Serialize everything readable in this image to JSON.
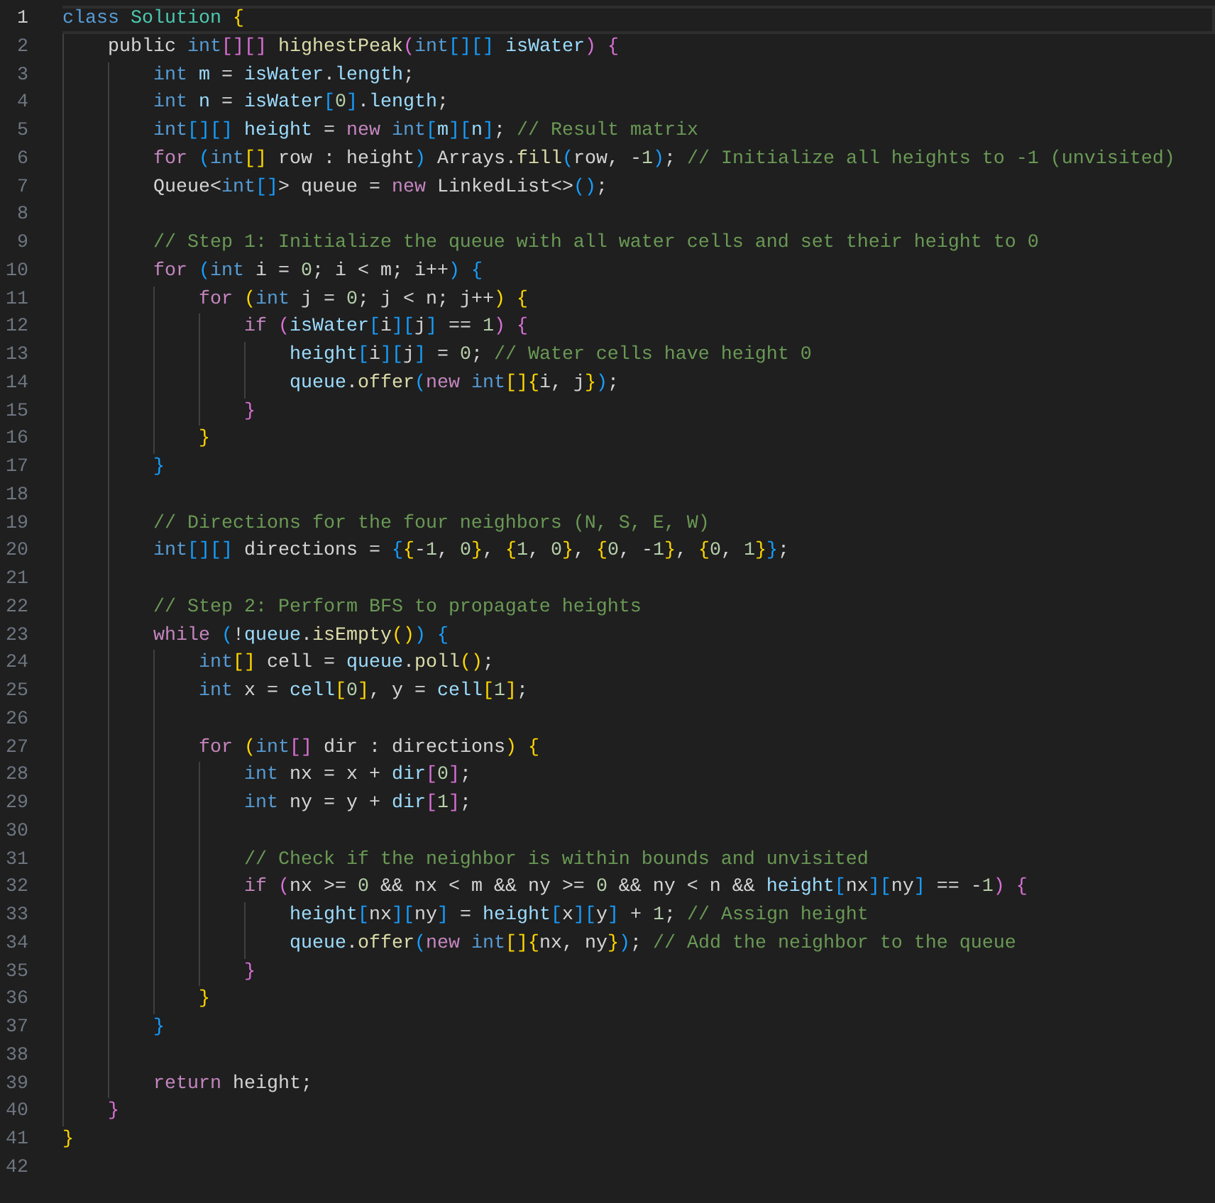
{
  "editor": {
    "lines": [
      {
        "number": "1",
        "selected": true,
        "tokens": [
          {
            "kind": "type",
            "text": "class"
          },
          {
            "kind": "class",
            "text": " Solution"
          },
          {
            "kind": "gold",
            "text": " {"
          }
        ]
      },
      {
        "number": "2",
        "selected": false,
        "tokens": [
          {
            "kind": "plain",
            "text": "    public "
          },
          {
            "kind": "type",
            "text": "int"
          },
          {
            "kind": "pink",
            "text": "[][]"
          },
          {
            "kind": "func",
            "text": " highestPeak"
          },
          {
            "kind": "pink",
            "text": "("
          },
          {
            "kind": "type",
            "text": "int"
          },
          {
            "kind": "blue",
            "text": "[][]"
          },
          {
            "kind": "var",
            "text": " isWater"
          },
          {
            "kind": "pink",
            "text": ")"
          },
          {
            "kind": "pink",
            "text": " {"
          }
        ]
      },
      {
        "number": "3",
        "selected": false,
        "tokens": [
          {
            "kind": "type",
            "text": "        int"
          },
          {
            "kind": "var",
            "text": " m"
          },
          {
            "kind": "plain",
            "text": " = "
          },
          {
            "kind": "var",
            "text": "isWater"
          },
          {
            "kind": "plain",
            "text": "."
          },
          {
            "kind": "var",
            "text": "length"
          },
          {
            "kind": "plain",
            "text": ";"
          }
        ]
      },
      {
        "number": "4",
        "selected": false,
        "tokens": [
          {
            "kind": "type",
            "text": "        int"
          },
          {
            "kind": "var",
            "text": " n"
          },
          {
            "kind": "plain",
            "text": " = "
          },
          {
            "kind": "var",
            "text": "isWater"
          },
          {
            "kind": "blue",
            "text": "["
          },
          {
            "kind": "num",
            "text": "0"
          },
          {
            "kind": "blue",
            "text": "]"
          },
          {
            "kind": "plain",
            "text": "."
          },
          {
            "kind": "var",
            "text": "length"
          },
          {
            "kind": "plain",
            "text": ";"
          }
        ]
      },
      {
        "number": "5",
        "selected": false,
        "tokens": [
          {
            "kind": "type",
            "text": "        int"
          },
          {
            "kind": "blue",
            "text": "[][]"
          },
          {
            "kind": "var",
            "text": " height"
          },
          {
            "kind": "plain",
            "text": " = "
          },
          {
            "kind": "control",
            "text": "new"
          },
          {
            "kind": "type",
            "text": " int"
          },
          {
            "kind": "blue",
            "text": "["
          },
          {
            "kind": "var",
            "text": "m"
          },
          {
            "kind": "blue",
            "text": "]["
          },
          {
            "kind": "var",
            "text": "n"
          },
          {
            "kind": "blue",
            "text": "]"
          },
          {
            "kind": "plain",
            "text": "; "
          },
          {
            "kind": "comment",
            "text": "// Result matrix"
          }
        ]
      },
      {
        "number": "6",
        "selected": false,
        "tokens": [
          {
            "kind": "control",
            "text": "        for"
          },
          {
            "kind": "blue",
            "text": " ("
          },
          {
            "kind": "type",
            "text": "int"
          },
          {
            "kind": "gold",
            "text": "[]"
          },
          {
            "kind": "plain",
            "text": " row : height"
          },
          {
            "kind": "blue",
            "text": ")"
          },
          {
            "kind": "plain",
            "text": " Arrays."
          },
          {
            "kind": "func",
            "text": "fill"
          },
          {
            "kind": "blue",
            "text": "("
          },
          {
            "kind": "plain",
            "text": "row, -"
          },
          {
            "kind": "num",
            "text": "1"
          },
          {
            "kind": "blue",
            "text": ")"
          },
          {
            "kind": "plain",
            "text": "; "
          },
          {
            "kind": "comment",
            "text": "// Initialize all heights to -1 (unvisited)"
          }
        ]
      },
      {
        "number": "7",
        "selected": false,
        "tokens": [
          {
            "kind": "plain",
            "text": "        Queue<"
          },
          {
            "kind": "type",
            "text": "int"
          },
          {
            "kind": "blue",
            "text": "[]"
          },
          {
            "kind": "plain",
            "text": "> queue = "
          },
          {
            "kind": "control",
            "text": "new"
          },
          {
            "kind": "plain",
            "text": " LinkedList<>"
          },
          {
            "kind": "blue",
            "text": "()"
          },
          {
            "kind": "plain",
            "text": ";"
          }
        ]
      },
      {
        "number": "8",
        "selected": false
      },
      {
        "number": "9",
        "selected": false,
        "tokens": [
          {
            "kind": "comment",
            "text": "        // Step 1: Initialize the queue with all water cells and set their height to 0"
          }
        ]
      },
      {
        "number": "10",
        "selected": false,
        "tokens": [
          {
            "kind": "control",
            "text": "        for"
          },
          {
            "kind": "blue",
            "text": " ("
          },
          {
            "kind": "type",
            "text": "int"
          },
          {
            "kind": "plain",
            "text": " i = "
          },
          {
            "kind": "num",
            "text": "0"
          },
          {
            "kind": "plain",
            "text": "; i < m; i++"
          },
          {
            "kind": "blue",
            "text": ")"
          },
          {
            "kind": "blue",
            "text": " {"
          }
        ]
      },
      {
        "number": "11",
        "selected": false,
        "tokens": [
          {
            "kind": "control",
            "text": "            for"
          },
          {
            "kind": "gold",
            "text": " ("
          },
          {
            "kind": "type",
            "text": "int"
          },
          {
            "kind": "plain",
            "text": " j = "
          },
          {
            "kind": "num",
            "text": "0"
          },
          {
            "kind": "plain",
            "text": "; j < n; j++"
          },
          {
            "kind": "gold",
            "text": ")"
          },
          {
            "kind": "gold",
            "text": " {"
          }
        ]
      },
      {
        "number": "12",
        "selected": false,
        "tokens": [
          {
            "kind": "control",
            "text": "                if"
          },
          {
            "kind": "pink",
            "text": " ("
          },
          {
            "kind": "var",
            "text": "isWater"
          },
          {
            "kind": "blue",
            "text": "["
          },
          {
            "kind": "plain",
            "text": "i"
          },
          {
            "kind": "blue",
            "text": "]["
          },
          {
            "kind": "plain",
            "text": "j"
          },
          {
            "kind": "blue",
            "text": "]"
          },
          {
            "kind": "plain",
            "text": " == "
          },
          {
            "kind": "num",
            "text": "1"
          },
          {
            "kind": "pink",
            "text": ")"
          },
          {
            "kind": "pink",
            "text": " {"
          }
        ]
      },
      {
        "number": "13",
        "selected": false,
        "tokens": [
          {
            "kind": "var",
            "text": "                    height"
          },
          {
            "kind": "blue",
            "text": "["
          },
          {
            "kind": "plain",
            "text": "i"
          },
          {
            "kind": "blue",
            "text": "]["
          },
          {
            "kind": "plain",
            "text": "j"
          },
          {
            "kind": "blue",
            "text": "]"
          },
          {
            "kind": "plain",
            "text": " = "
          },
          {
            "kind": "num",
            "text": "0"
          },
          {
            "kind": "plain",
            "text": "; "
          },
          {
            "kind": "comment",
            "text": "// Water cells have height 0"
          }
        ]
      },
      {
        "number": "14",
        "selected": false,
        "tokens": [
          {
            "kind": "var",
            "text": "                    queue"
          },
          {
            "kind": "plain",
            "text": "."
          },
          {
            "kind": "func",
            "text": "offer"
          },
          {
            "kind": "blue",
            "text": "("
          },
          {
            "kind": "control",
            "text": "new"
          },
          {
            "kind": "type",
            "text": " int"
          },
          {
            "kind": "gold",
            "text": "[]{"
          },
          {
            "kind": "plain",
            "text": "i, j"
          },
          {
            "kind": "gold",
            "text": "}"
          },
          {
            "kind": "blue",
            "text": ")"
          },
          {
            "kind": "plain",
            "text": ";"
          }
        ]
      },
      {
        "number": "15",
        "selected": false,
        "tokens": [
          {
            "kind": "pink",
            "text": "                }"
          }
        ]
      },
      {
        "number": "16",
        "selected": false,
        "tokens": [
          {
            "kind": "gold",
            "text": "            }"
          }
        ]
      },
      {
        "number": "17",
        "selected": false,
        "tokens": [
          {
            "kind": "blue",
            "text": "        }"
          }
        ]
      },
      {
        "number": "18",
        "selected": false
      },
      {
        "number": "19",
        "selected": false,
        "tokens": [
          {
            "kind": "comment",
            "text": "        // Directions for the four neighbors (N, S, E, W)"
          }
        ]
      },
      {
        "number": "20",
        "selected": false,
        "tokens": [
          {
            "kind": "type",
            "text": "        int"
          },
          {
            "kind": "blue",
            "text": "[][]"
          },
          {
            "kind": "plain",
            "text": " directions = "
          },
          {
            "kind": "blue",
            "text": "{"
          },
          {
            "kind": "gold",
            "text": "{"
          },
          {
            "kind": "plain",
            "text": "-"
          },
          {
            "kind": "num",
            "text": "1"
          },
          {
            "kind": "plain",
            "text": ", "
          },
          {
            "kind": "num",
            "text": "0"
          },
          {
            "kind": "gold",
            "text": "}"
          },
          {
            "kind": "plain",
            "text": ", "
          },
          {
            "kind": "gold",
            "text": "{"
          },
          {
            "kind": "num",
            "text": "1"
          },
          {
            "kind": "plain",
            "text": ", "
          },
          {
            "kind": "num",
            "text": "0"
          },
          {
            "kind": "gold",
            "text": "}"
          },
          {
            "kind": "plain",
            "text": ", "
          },
          {
            "kind": "gold",
            "text": "{"
          },
          {
            "kind": "num",
            "text": "0"
          },
          {
            "kind": "plain",
            "text": ", -"
          },
          {
            "kind": "num",
            "text": "1"
          },
          {
            "kind": "gold",
            "text": "}"
          },
          {
            "kind": "plain",
            "text": ", "
          },
          {
            "kind": "gold",
            "text": "{"
          },
          {
            "kind": "num",
            "text": "0"
          },
          {
            "kind": "plain",
            "text": ", "
          },
          {
            "kind": "num",
            "text": "1"
          },
          {
            "kind": "gold",
            "text": "}"
          },
          {
            "kind": "blue",
            "text": "}"
          },
          {
            "kind": "plain",
            "text": ";"
          }
        ]
      },
      {
        "number": "21",
        "selected": false
      },
      {
        "number": "22",
        "selected": false,
        "tokens": [
          {
            "kind": "comment",
            "text": "        // Step 2: Perform BFS to propagate heights"
          }
        ]
      },
      {
        "number": "23",
        "selected": false,
        "tokens": [
          {
            "kind": "control",
            "text": "        while"
          },
          {
            "kind": "blue",
            "text": " ("
          },
          {
            "kind": "plain",
            "text": "!"
          },
          {
            "kind": "var",
            "text": "queue"
          },
          {
            "kind": "plain",
            "text": "."
          },
          {
            "kind": "func",
            "text": "isEmpty"
          },
          {
            "kind": "gold",
            "text": "()"
          },
          {
            "kind": "blue",
            "text": ")"
          },
          {
            "kind": "blue",
            "text": " {"
          }
        ]
      },
      {
        "number": "24",
        "selected": false,
        "tokens": [
          {
            "kind": "type",
            "text": "            int"
          },
          {
            "kind": "gold",
            "text": "[]"
          },
          {
            "kind": "plain",
            "text": " cell = "
          },
          {
            "kind": "var",
            "text": "queue"
          },
          {
            "kind": "plain",
            "text": "."
          },
          {
            "kind": "func",
            "text": "poll"
          },
          {
            "kind": "gold",
            "text": "()"
          },
          {
            "kind": "plain",
            "text": ";"
          }
        ]
      },
      {
        "number": "25",
        "selected": false,
        "tokens": [
          {
            "kind": "type",
            "text": "            int"
          },
          {
            "kind": "plain",
            "text": " x = "
          },
          {
            "kind": "var",
            "text": "cell"
          },
          {
            "kind": "gold",
            "text": "["
          },
          {
            "kind": "num",
            "text": "0"
          },
          {
            "kind": "gold",
            "text": "]"
          },
          {
            "kind": "plain",
            "text": ", y = "
          },
          {
            "kind": "var",
            "text": "cell"
          },
          {
            "kind": "gold",
            "text": "["
          },
          {
            "kind": "num",
            "text": "1"
          },
          {
            "kind": "gold",
            "text": "]"
          },
          {
            "kind": "plain",
            "text": ";"
          }
        ]
      },
      {
        "number": "26",
        "selected": false
      },
      {
        "number": "27",
        "selected": false,
        "tokens": [
          {
            "kind": "control",
            "text": "            for"
          },
          {
            "kind": "gold",
            "text": " ("
          },
          {
            "kind": "type",
            "text": "int"
          },
          {
            "kind": "pink",
            "text": "[]"
          },
          {
            "kind": "plain",
            "text": " dir : directions"
          },
          {
            "kind": "gold",
            "text": ")"
          },
          {
            "kind": "gold",
            "text": " {"
          }
        ]
      },
      {
        "number": "28",
        "selected": false,
        "tokens": [
          {
            "kind": "type",
            "text": "                int"
          },
          {
            "kind": "plain",
            "text": " nx = x + "
          },
          {
            "kind": "var",
            "text": "dir"
          },
          {
            "kind": "pink",
            "text": "["
          },
          {
            "kind": "num",
            "text": "0"
          },
          {
            "kind": "pink",
            "text": "]"
          },
          {
            "kind": "plain",
            "text": ";"
          }
        ]
      },
      {
        "number": "29",
        "selected": false,
        "tokens": [
          {
            "kind": "type",
            "text": "                int"
          },
          {
            "kind": "plain",
            "text": " ny = y + "
          },
          {
            "kind": "var",
            "text": "dir"
          },
          {
            "kind": "pink",
            "text": "["
          },
          {
            "kind": "num",
            "text": "1"
          },
          {
            "kind": "pink",
            "text": "]"
          },
          {
            "kind": "plain",
            "text": ";"
          }
        ]
      },
      {
        "number": "30",
        "selected": false
      },
      {
        "number": "31",
        "selected": false,
        "tokens": [
          {
            "kind": "comment",
            "text": "                // Check if the neighbor is within bounds and unvisited"
          }
        ]
      },
      {
        "number": "32",
        "selected": false,
        "tokens": [
          {
            "kind": "control",
            "text": "                if"
          },
          {
            "kind": "pink",
            "text": " ("
          },
          {
            "kind": "plain",
            "text": "nx >= "
          },
          {
            "kind": "num",
            "text": "0"
          },
          {
            "kind": "plain",
            "text": " && nx < m && ny >= "
          },
          {
            "kind": "num",
            "text": "0"
          },
          {
            "kind": "plain",
            "text": " && ny < n && "
          },
          {
            "kind": "var",
            "text": "height"
          },
          {
            "kind": "blue",
            "text": "["
          },
          {
            "kind": "plain",
            "text": "nx"
          },
          {
            "kind": "blue",
            "text": "]["
          },
          {
            "kind": "plain",
            "text": "ny"
          },
          {
            "kind": "blue",
            "text": "]"
          },
          {
            "kind": "plain",
            "text": " == -"
          },
          {
            "kind": "num",
            "text": "1"
          },
          {
            "kind": "pink",
            "text": ")"
          },
          {
            "kind": "pink",
            "text": " {"
          }
        ]
      },
      {
        "number": "33",
        "selected": false,
        "tokens": [
          {
            "kind": "var",
            "text": "                    height"
          },
          {
            "kind": "blue",
            "text": "["
          },
          {
            "kind": "plain",
            "text": "nx"
          },
          {
            "kind": "blue",
            "text": "]["
          },
          {
            "kind": "plain",
            "text": "ny"
          },
          {
            "kind": "blue",
            "text": "]"
          },
          {
            "kind": "plain",
            "text": " = "
          },
          {
            "kind": "var",
            "text": "height"
          },
          {
            "kind": "blue",
            "text": "["
          },
          {
            "kind": "plain",
            "text": "x"
          },
          {
            "kind": "blue",
            "text": "]["
          },
          {
            "kind": "plain",
            "text": "y"
          },
          {
            "kind": "blue",
            "text": "]"
          },
          {
            "kind": "plain",
            "text": " + "
          },
          {
            "kind": "num",
            "text": "1"
          },
          {
            "kind": "plain",
            "text": "; "
          },
          {
            "kind": "comment",
            "text": "// Assign height"
          }
        ]
      },
      {
        "number": "34",
        "selected": false,
        "tokens": [
          {
            "kind": "var",
            "text": "                    queue"
          },
          {
            "kind": "plain",
            "text": "."
          },
          {
            "kind": "func",
            "text": "offer"
          },
          {
            "kind": "blue",
            "text": "("
          },
          {
            "kind": "control",
            "text": "new"
          },
          {
            "kind": "type",
            "text": " int"
          },
          {
            "kind": "gold",
            "text": "[]{"
          },
          {
            "kind": "plain",
            "text": "nx, ny"
          },
          {
            "kind": "gold",
            "text": "}"
          },
          {
            "kind": "blue",
            "text": ")"
          },
          {
            "kind": "plain",
            "text": "; "
          },
          {
            "kind": "comment",
            "text": "// Add the neighbor to the queue"
          }
        ]
      },
      {
        "number": "35",
        "selected": false,
        "tokens": [
          {
            "kind": "pink",
            "text": "                }"
          }
        ]
      },
      {
        "number": "36",
        "selected": false,
        "tokens": [
          {
            "kind": "gold",
            "text": "            }"
          }
        ]
      },
      {
        "number": "37",
        "selected": false,
        "tokens": [
          {
            "kind": "blue",
            "text": "        }"
          }
        ]
      },
      {
        "number": "38",
        "selected": false
      },
      {
        "number": "39",
        "selected": false,
        "tokens": [
          {
            "kind": "control",
            "text": "        return"
          },
          {
            "kind": "plain",
            "text": " height;"
          }
        ]
      },
      {
        "number": "40",
        "selected": false,
        "tokens": [
          {
            "kind": "pink",
            "text": "    }"
          }
        ]
      },
      {
        "number": "41",
        "selected": false,
        "tokens": [
          {
            "kind": "gold",
            "text": "}"
          }
        ]
      },
      {
        "number": "42",
        "selected": false
      }
    ]
  }
}
